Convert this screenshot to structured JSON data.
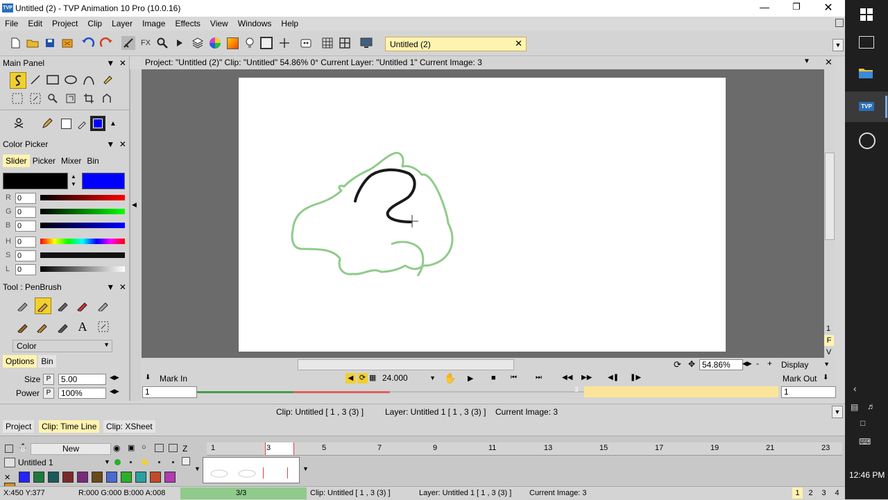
{
  "window": {
    "title": "Untitled (2) - TVP Animation 10 Pro (10.0.16)",
    "app_badge": "TVP"
  },
  "menu": [
    "File",
    "Edit",
    "Project",
    "Clip",
    "Layer",
    "Image",
    "Effects",
    "View",
    "Windows",
    "Help"
  ],
  "doc_tab": {
    "label": "Untitled (2)"
  },
  "main_panel": {
    "title": "Main Panel"
  },
  "color_picker": {
    "title": "Color Picker",
    "tabs": [
      "Slider",
      "Picker",
      "Mixer",
      "Bin"
    ],
    "primary_color": "#000000",
    "secondary_color": "#0000ff",
    "channels": [
      {
        "label": "R",
        "value": "0"
      },
      {
        "label": "G",
        "value": "0"
      },
      {
        "label": "B",
        "value": "0"
      },
      {
        "label": "H",
        "value": "0"
      },
      {
        "label": "S",
        "value": "0"
      },
      {
        "label": "L",
        "value": "0"
      }
    ]
  },
  "tool_panel": {
    "title": "Tool : PenBrush",
    "mode_select": "Color",
    "tabs": [
      "Options",
      "Bin"
    ],
    "size_label": "Size",
    "size_value": "5.00",
    "power_label": "Power",
    "power_value": "100%",
    "p_button": "P"
  },
  "viewport": {
    "info": "Project:  \"Untitled (2)\"  Clip: \"Untitled\"   54.86%   0°  Current Layer: \"Untitled 1\"   Current Image: 3",
    "zoom": "54.86%",
    "display_label": "Display",
    "side_letters": [
      "1",
      "F",
      "V"
    ]
  },
  "playback": {
    "mark_in": "Mark In",
    "mark_out": "Mark Out",
    "fps": "24.000",
    "in_frame": "1",
    "out_frame": "1",
    "current_marker": "3"
  },
  "clip_info": {
    "clip": "Clip: Untitled [ 1 , 3  (3) ]",
    "layer": "Layer: Untitled 1 [ 1 , 3  (3) ]",
    "image": "Current Image: 3"
  },
  "bottom_tabs": [
    "Project",
    "Clip: Time Line",
    "Clip: XSheet"
  ],
  "timeline": {
    "new_label": "New",
    "z_label": "Z",
    "layer_name": "Untitled 1",
    "ruler": [
      "1",
      "3",
      "5",
      "7",
      "9",
      "11",
      "13",
      "15",
      "17",
      "19",
      "21",
      "23"
    ],
    "swatch_colors": [
      "#2424ff",
      "#1e7a3c",
      "#1a5a5a",
      "#7a2a2a",
      "#7a2a7a",
      "#6a4a1a",
      "#4a6ad0",
      "#2ab02a",
      "#2aa0a0",
      "#c04a2a",
      "#b03ab0",
      "#d09020"
    ]
  },
  "status": {
    "coords": "X:450  Y:377",
    "rgba": "R:000 G:000 B:000 A:008",
    "frames": "3/3",
    "clip": "Clip: Untitled [ 1 , 3  (3) ]",
    "layer": "Layer: Untitled 1 [ 1 , 3  (3) ]",
    "image": "Current Image: 3",
    "pages": [
      "1",
      "2",
      "3",
      "4"
    ]
  },
  "taskbar": {
    "time": "12:46 PM",
    "tvp_label": "TVP"
  }
}
